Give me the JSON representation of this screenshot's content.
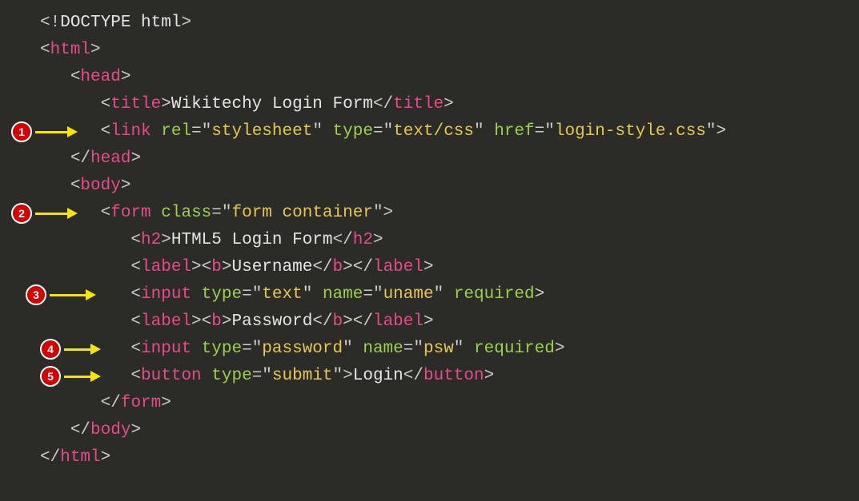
{
  "lines": [
    {
      "indent": 0,
      "type": "doctype",
      "tag": "DOCTYPE",
      "word": "html"
    },
    {
      "indent": 0,
      "type": "open",
      "tag": "html"
    },
    {
      "indent": 1,
      "type": "open",
      "tag": "head"
    },
    {
      "indent": 2,
      "type": "wrap",
      "tag": "title",
      "text": "Wikitechy Login Form"
    },
    {
      "indent": 2,
      "type": "selfopen",
      "tag": "link",
      "attrs": [
        {
          "name": "rel",
          "value": "stylesheet"
        },
        {
          "name": "type",
          "value": "text/css"
        },
        {
          "name": "href",
          "value": "login-style.css"
        }
      ]
    },
    {
      "indent": 1,
      "type": "close",
      "tag": "head"
    },
    {
      "indent": 1,
      "type": "open",
      "tag": "body"
    },
    {
      "indent": 2,
      "type": "selfopen",
      "tag": "form",
      "attrs": [
        {
          "name": "class",
          "value": "form container"
        }
      ]
    },
    {
      "indent": 3,
      "type": "wrap",
      "tag": "h2",
      "text": "HTML5 Login Form"
    },
    {
      "indent": 3,
      "type": "labelbold",
      "text": "Username"
    },
    {
      "indent": 3,
      "type": "selfopen",
      "tag": "input",
      "attrs": [
        {
          "name": "type",
          "value": "text"
        },
        {
          "name": "name",
          "value": "uname"
        },
        {
          "name": "required"
        }
      ]
    },
    {
      "indent": 3,
      "type": "labelbold",
      "text": "Password"
    },
    {
      "indent": 3,
      "type": "selfopen",
      "tag": "input",
      "attrs": [
        {
          "name": "type",
          "value": "password"
        },
        {
          "name": "name",
          "value": "psw"
        },
        {
          "name": "required"
        }
      ]
    },
    {
      "indent": 3,
      "type": "buttonwrap",
      "tag": "button",
      "attrs": [
        {
          "name": "type",
          "value": "submit"
        }
      ],
      "text": "Login"
    },
    {
      "indent": 2,
      "type": "close",
      "tag": "form"
    },
    {
      "indent": 1,
      "type": "close",
      "tag": "body"
    },
    {
      "indent": 0,
      "type": "close",
      "tag": "html"
    }
  ],
  "annotations": [
    {
      "num": "1",
      "lineIndex": 4,
      "extraIndent": 0,
      "shaft": 40
    },
    {
      "num": "2",
      "lineIndex": 7,
      "extraIndent": 0,
      "shaft": 40
    },
    {
      "num": "3",
      "lineIndex": 10,
      "extraIndent": 1,
      "shaft": 45
    },
    {
      "num": "4",
      "lineIndex": 12,
      "extraIndent": 2,
      "shaft": 33
    },
    {
      "num": "5",
      "lineIndex": 13,
      "extraIndent": 2,
      "shaft": 33
    }
  ],
  "layout": {
    "codeLeft": 50,
    "lineTop0": 12,
    "lineH": 34,
    "indentUnit": "   "
  }
}
